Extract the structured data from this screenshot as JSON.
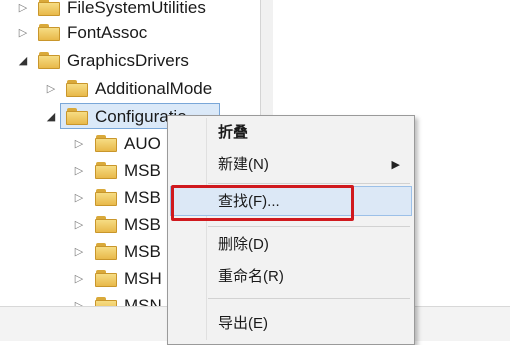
{
  "tree": {
    "items": [
      {
        "label": "FileSystemUtilities",
        "expander": "▷"
      },
      {
        "label": "FontAssoc",
        "expander": "▷"
      },
      {
        "label": "GraphicsDrivers",
        "expander": "◢"
      },
      {
        "label": "AdditionalMode",
        "expander": "▷"
      },
      {
        "label": "Configuratio",
        "expander": "◢"
      },
      {
        "label": "AUO",
        "expander": "▷"
      },
      {
        "label": "MSB",
        "expander": "▷"
      },
      {
        "label": "MSB",
        "expander": "▷"
      },
      {
        "label": "MSB",
        "expander": "▷"
      },
      {
        "label": "MSB",
        "expander": "▷"
      },
      {
        "label": "MSH",
        "expander": "▷"
      },
      {
        "label": "MSN",
        "expander": "▷"
      }
    ]
  },
  "context_menu": {
    "items": [
      {
        "label": "折叠"
      },
      {
        "label": "新建(N)",
        "submenu_arrow": "▶"
      },
      {
        "label": "查找(F)..."
      },
      {
        "label": "删除(D)"
      },
      {
        "label": "重命名(R)"
      },
      {
        "label": "导出(E)"
      }
    ]
  },
  "colors": {
    "highlight_frame": "#d0191e",
    "selection": "#dbe9f8"
  },
  "icons": {
    "folder": "folder-icon",
    "expand": "expand-arrow-icon",
    "collapse": "collapse-arrow-icon"
  }
}
